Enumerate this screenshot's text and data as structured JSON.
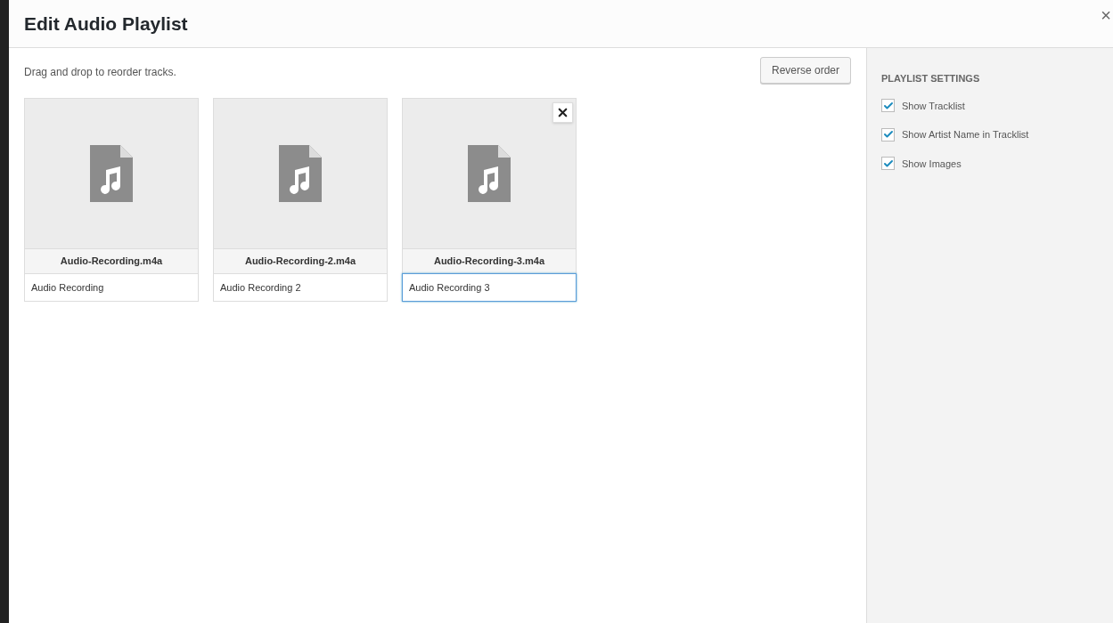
{
  "modal": {
    "title": "Edit Audio Playlist",
    "close": "×"
  },
  "hint": "Drag and drop to reorder tracks.",
  "reverse_button": "Reverse order",
  "tracks": [
    {
      "filename": "Audio-Recording.m4a",
      "title": "Audio Recording",
      "focused": false
    },
    {
      "filename": "Audio-Recording-2.m4a",
      "title": "Audio Recording 2",
      "focused": false
    },
    {
      "filename": "Audio-Recording-3.m4a",
      "title": "Audio Recording 3",
      "focused": true
    }
  ],
  "settings": {
    "heading": "PLAYLIST SETTINGS",
    "options": [
      {
        "label": "Show Tracklist",
        "checked": true
      },
      {
        "label": "Show Artist Name in Tracklist",
        "checked": true
      },
      {
        "label": "Show Images",
        "checked": true
      }
    ]
  }
}
